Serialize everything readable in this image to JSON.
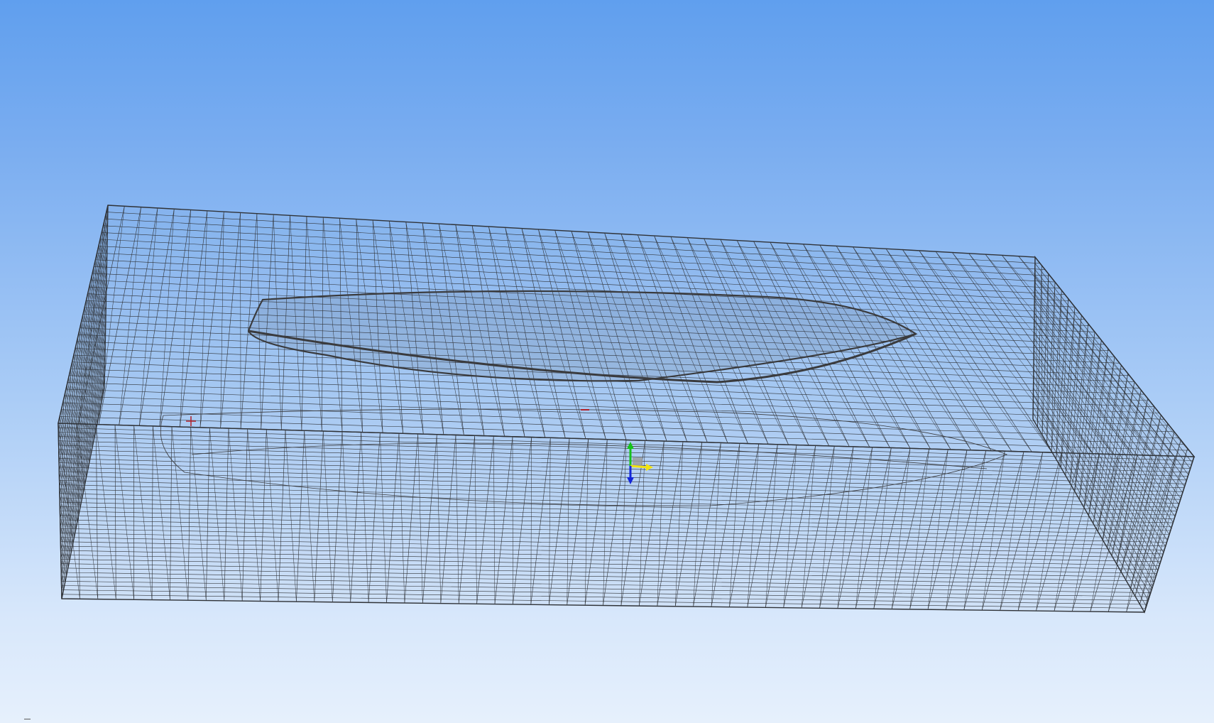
{
  "viewport": {
    "background_top": "#609fee",
    "background_bottom": "#e6f0fc"
  },
  "mesh": {
    "line_color": "#2f3237",
    "hull_color": "#3a3b3e"
  },
  "triad": {
    "x_color": "#f2e311",
    "y_color": "#15c21b",
    "z_color": "#1326d8",
    "origin_color": "#9a9a9a"
  },
  "markers": {
    "color": "#b0212a"
  }
}
